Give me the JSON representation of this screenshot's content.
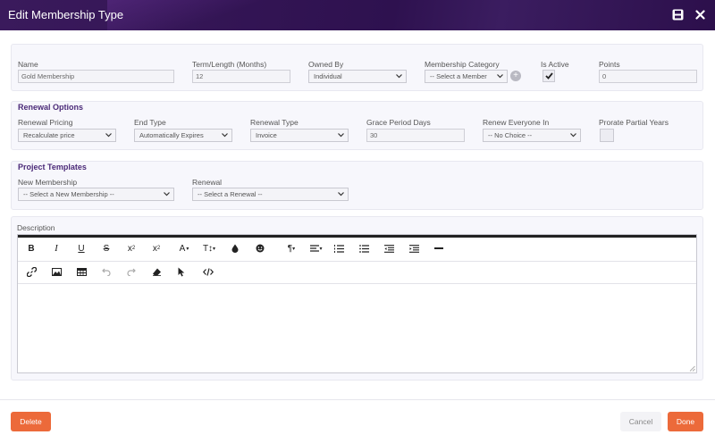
{
  "window": {
    "title": "Edit Membership Type"
  },
  "icons": {
    "save": "save-icon",
    "close": "close-icon"
  },
  "general": {
    "name_label": "Name",
    "name_value": "Gold Membership",
    "term_label": "Term/Length (Months)",
    "term_value": "12",
    "owned_by_label": "Owned By",
    "owned_by_value": "Individual",
    "category_label": "Membership Category",
    "category_value": "-- Select a Member",
    "is_active_label": "Is Active",
    "is_active": true,
    "points_label": "Points",
    "points_value": "0"
  },
  "renewal": {
    "section_title": "Renewal Options",
    "pricing_label": "Renewal Pricing",
    "pricing_value": "Recalculate price",
    "end_type_label": "End Type",
    "end_type_value": "Automatically Expires",
    "renewal_type_label": "Renewal Type",
    "renewal_type_value": "Invoice",
    "grace_label": "Grace Period Days",
    "grace_value": "30",
    "renew_everyone_label": "Renew Everyone In",
    "renew_everyone_value": "-- No Choice --",
    "prorate_label": "Prorate Partial Years",
    "prorate": false
  },
  "templates": {
    "section_title": "Project Templates",
    "new_membership_label": "New Membership",
    "new_membership_value": "-- Select a New Membership --",
    "renewal_label": "Renewal",
    "renewal_value": "-- Select a Renewal --"
  },
  "description": {
    "label": "Description",
    "content": ""
  },
  "footer": {
    "delete_label": "Delete",
    "cancel_label": "Cancel",
    "done_label": "Done"
  },
  "colors": {
    "title_bar": "#2e114f",
    "accent": "#ec6a3a",
    "section_title": "#4b2a78"
  }
}
